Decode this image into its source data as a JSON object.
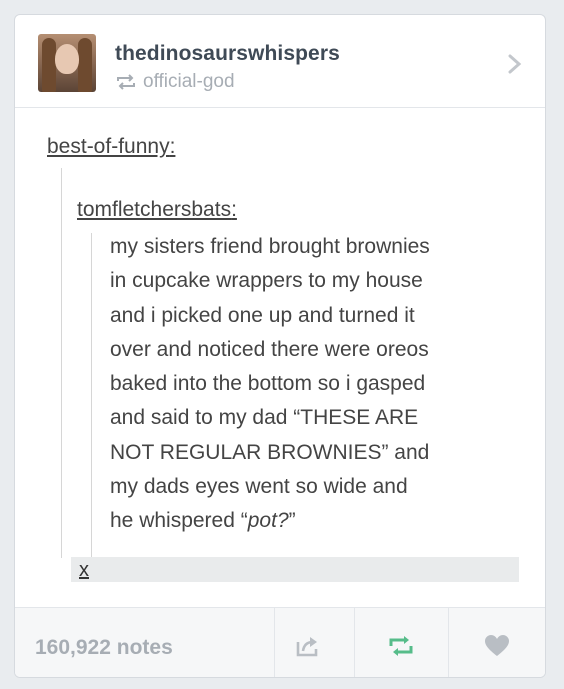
{
  "post": {
    "username": "thedinosaurswhispers",
    "reblogged_from": "official-god",
    "sources": [
      "best-of-funny",
      "tomfletchersbats"
    ],
    "quote_lines": [
      "my sisters friend brought brownies",
      "in cupcake wrappers to my house",
      "and i picked one up and turned it",
      "over and noticed there were oreos",
      "baked into the bottom so i gasped",
      "and said to my dad “THESE ARE",
      "NOT REGULAR BROWNIES” and",
      "my dads eyes went so wide and",
      "he whispered “"
    ],
    "quote_emphasis": "pot?",
    "quote_end": "”",
    "x_label": "x"
  },
  "footer": {
    "notes": "160,922 notes"
  },
  "colors": {
    "text": "#444444",
    "muted": "#a7adb4",
    "reblog_green": "#56bc8a",
    "username": "#3f4a56"
  },
  "icons": [
    "reblog-small-icon",
    "chevron-right-icon",
    "share-icon",
    "reblog-icon",
    "heart-icon"
  ]
}
